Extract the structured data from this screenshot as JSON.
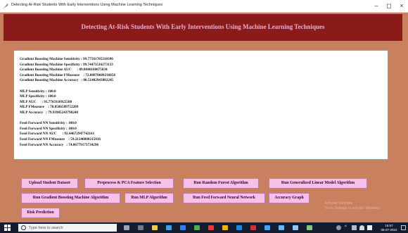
{
  "window": {
    "title": "Detecting At-Risk Students With Early Interventions Using Machine Learning Techniques",
    "minimize": "–",
    "maximize": "◻",
    "close": "×"
  },
  "header": {
    "title": "Detecting At-Risk Students With Early Interventions Using Machine Learning Techniques"
  },
  "output": {
    "lines": [
      "Gradient Boosting Machine Sensitivity : 99.77561705310396",
      "Gradient Boosting Machine Specificity : 99.74473516273133",
      "Gradient Boosting Machine AUC      : 89.8046168675834",
      "Gradient Boosting Machine FMeasure    : 72.08870609216656",
      "Gradient Boosting Machine Accuracy   : 80.51402943882245",
      "",
      "MLP Sensitivity : 100.0",
      "MLP Specificity : 100.0",
      "MLP AUC      : 93.7763110925508",
      "MLP FMeasure    : 70.8586589752209",
      "MLP Accuracy   : 79.93905243790248",
      "",
      "Feed Forward NN Sensitivity : 100.0",
      "Feed Forward NN Specificity : 100.0",
      "Feed Forward NN AUC      : 92.44672947742161",
      "Feed Forward NN FMeasure    : 59.21246800215816",
      "Feed Forward NN Accuracy   : 74.06779173734296"
    ]
  },
  "buttons": {
    "upload": "Upload Student Dataset",
    "preprocess": "Preprocess & PCA Feature Selection",
    "random_forest": "Run Random Forest Algorithm",
    "glm": "Run Generalized Linear Model Algorithm",
    "gbm": "Run Gradient Boosting Machine Algorithm",
    "mlp": "Run MLP Algorithm",
    "ffnn": "Run Feed Forward Neural Network",
    "accuracy_graph": "Accuracy Graph",
    "risk_prediction": "Risk Prediction"
  },
  "watermark": {
    "line1": "Activate Windows",
    "line2": "Go to Settings to activate Windows."
  },
  "taskbar": {
    "search_placeholder": "Type here to search",
    "time": "16:57",
    "date": "06-07-2022"
  },
  "colors": {
    "background": "#c9805f",
    "header": "#8b1a1a",
    "header_text": "#e5b0d6",
    "button": "#f8bfe9",
    "taskbar": "#141c2e"
  },
  "icons": {
    "app": "feather-icon",
    "start": "windows-start-icon",
    "search": "search-icon"
  }
}
